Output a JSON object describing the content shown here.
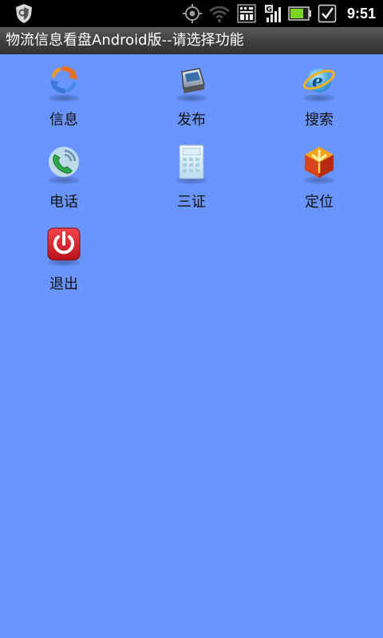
{
  "status_bar": {
    "time": "9:51",
    "icons": [
      "shield-icon",
      "gps-icon",
      "wifi-icon",
      "signal-test-icon",
      "edge-signal-icon",
      "battery-icon",
      "check-notification-icon"
    ],
    "battery_level": 0.75
  },
  "title_bar": {
    "title": "物流信息看盘Android版--请选择功能"
  },
  "menu": {
    "items": [
      {
        "label": "信息",
        "icon": "sync-icon"
      },
      {
        "label": "发布",
        "icon": "scanner-icon"
      },
      {
        "label": "搜索",
        "icon": "browser-icon"
      },
      {
        "label": "电话",
        "icon": "phone-icon"
      },
      {
        "label": "三证",
        "icon": "calculator-icon"
      },
      {
        "label": "定位",
        "icon": "locate-cube-icon"
      },
      {
        "label": "退出",
        "icon": "power-icon"
      }
    ]
  },
  "colors": {
    "background": "#6a95ff",
    "status_bar": "#000000",
    "title_bar": "#3e3e3e"
  }
}
